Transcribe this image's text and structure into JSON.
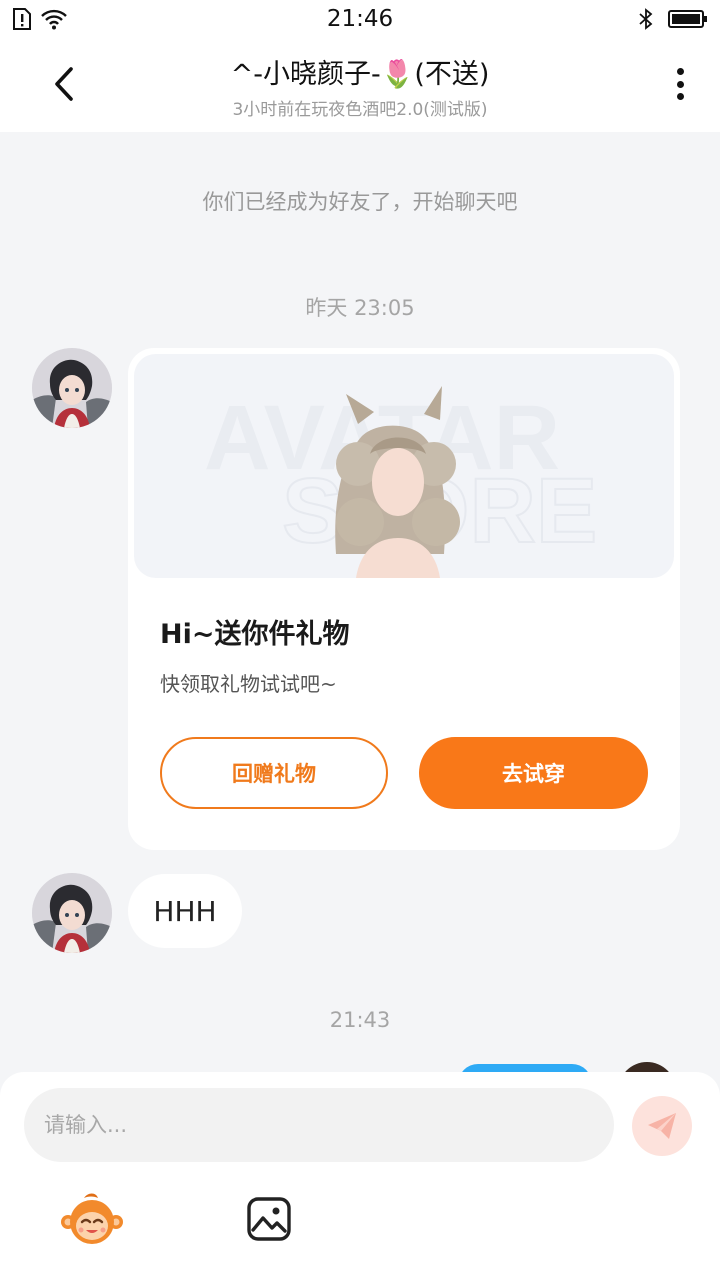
{
  "status_bar": {
    "time": "21:46"
  },
  "header": {
    "title": "^-小晓颜子-🌷(不送)",
    "subtitle": "3小时前在玩夜色酒吧2.0(测试版)"
  },
  "chat": {
    "system_notice": "你们已经成为好友了，开始聊天吧",
    "timestamps": [
      "昨天 23:05",
      "21:43"
    ],
    "gift_card": {
      "watermark_line1": "AVATAR",
      "watermark_line2": "STORE",
      "title": "Hi~送你件礼物",
      "description": "快领取礼物试试吧~",
      "return_gift_label": "回赠礼物",
      "try_on_label": "去试穿"
    },
    "text_message": "HHH"
  },
  "input": {
    "placeholder": "请输入..."
  },
  "colors": {
    "accent": "#f97818",
    "sent_bubble": "#2eaaf5",
    "background": "#f4f5f7"
  }
}
